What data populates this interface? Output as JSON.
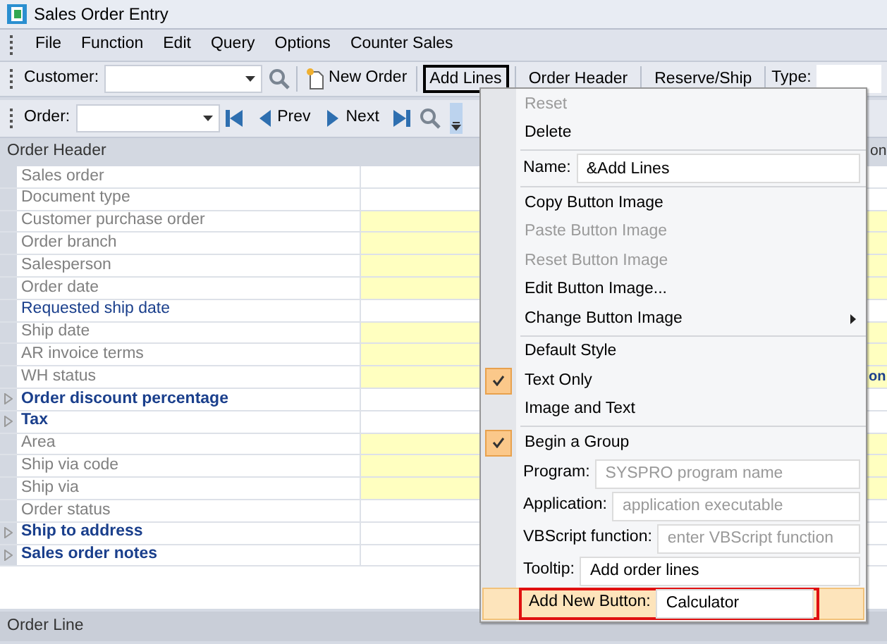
{
  "window": {
    "title": "Sales Order Entry"
  },
  "menu_bar": [
    "File",
    "Function",
    "Edit",
    "Query",
    "Options",
    "Counter Sales"
  ],
  "toolbar_1": {
    "customer_label": "Customer:",
    "new_order": "New Order",
    "buttons": [
      {
        "label": "Add Lines",
        "selected": true
      },
      {
        "label": "Order Header",
        "selected": false
      },
      {
        "label": "Reserve/Ship",
        "selected": false
      }
    ],
    "type_label": "Type:"
  },
  "toolbar_2": {
    "order_label": "Order:",
    "prev": "Prev",
    "next": "Next"
  },
  "order_header": {
    "title": "Order Header",
    "rows": [
      {
        "label": "Sales order",
        "kind": "field",
        "required": false,
        "emphasis": false
      },
      {
        "label": "Document type",
        "kind": "field",
        "required": false,
        "emphasis": false
      },
      {
        "label": "Customer purchase order",
        "kind": "field",
        "required": true,
        "emphasis": false
      },
      {
        "label": "Order branch",
        "kind": "field",
        "required": true,
        "emphasis": false
      },
      {
        "label": "Salesperson",
        "kind": "field",
        "required": true,
        "emphasis": false
      },
      {
        "label": "Order date",
        "kind": "field",
        "required": true,
        "emphasis": false
      },
      {
        "label": "Requested ship date",
        "kind": "field",
        "required": false,
        "emphasis": true
      },
      {
        "label": "Ship date",
        "kind": "field",
        "required": true,
        "emphasis": false
      },
      {
        "label": "AR invoice terms",
        "kind": "field",
        "required": true,
        "emphasis": false
      },
      {
        "label": "WH status",
        "kind": "field",
        "required": true,
        "emphasis": false
      },
      {
        "label": "Order discount percentage",
        "kind": "group",
        "expanded": false
      },
      {
        "label": "Tax",
        "kind": "group",
        "expanded": false
      },
      {
        "label": "Area",
        "kind": "field",
        "required": true,
        "emphasis": false
      },
      {
        "label": "Ship via code",
        "kind": "field",
        "required": true,
        "emphasis": false
      },
      {
        "label": "Ship via",
        "kind": "field",
        "required": true,
        "emphasis": false
      },
      {
        "label": "Order status",
        "kind": "field",
        "required": false,
        "emphasis": false
      },
      {
        "label": "Ship to address",
        "kind": "group",
        "expanded": false
      },
      {
        "label": "Sales order notes",
        "kind": "group",
        "expanded": false
      }
    ]
  },
  "right_fragments": [
    "on",
    "on"
  ],
  "order_line": {
    "title": "Order Line"
  },
  "context_menu": [
    {
      "kind": "item",
      "label": "Reset",
      "disabled": true,
      "checked": false
    },
    {
      "kind": "item",
      "label": "Delete",
      "disabled": false,
      "checked": false
    },
    {
      "kind": "separator"
    },
    {
      "kind": "field",
      "label": "Name:",
      "value": "&Add Lines"
    },
    {
      "kind": "separator"
    },
    {
      "kind": "item",
      "label": "Copy Button Image",
      "disabled": false,
      "checked": false
    },
    {
      "kind": "item",
      "label": "Paste Button Image",
      "disabled": true,
      "checked": false
    },
    {
      "kind": "item",
      "label": "Reset Button Image",
      "disabled": true,
      "checked": false
    },
    {
      "kind": "item",
      "label": "Edit Button Image...",
      "disabled": false,
      "checked": false
    },
    {
      "kind": "submenu",
      "label": "Change Button Image"
    },
    {
      "kind": "separator"
    },
    {
      "kind": "item",
      "label": "Default Style",
      "disabled": false,
      "checked": false
    },
    {
      "kind": "item",
      "label": "Text Only",
      "disabled": false,
      "checked": true
    },
    {
      "kind": "item",
      "label": "Image and Text",
      "disabled": false,
      "checked": false
    },
    {
      "kind": "separator"
    },
    {
      "kind": "item",
      "label": "Begin a Group",
      "disabled": false,
      "checked": true
    },
    {
      "kind": "field",
      "label": "Program:",
      "placeholder": "SYSPRO program name"
    },
    {
      "kind": "field",
      "label": "Application:",
      "placeholder": "application executable"
    },
    {
      "kind": "field",
      "label": "VBScript function:",
      "placeholder": "enter VBScript function"
    },
    {
      "kind": "field",
      "label": "Tooltip:",
      "value": "Add order lines"
    },
    {
      "kind": "field",
      "label": "Add New Button:",
      "value": "Calculator",
      "selected": true,
      "highlighted": true
    }
  ]
}
